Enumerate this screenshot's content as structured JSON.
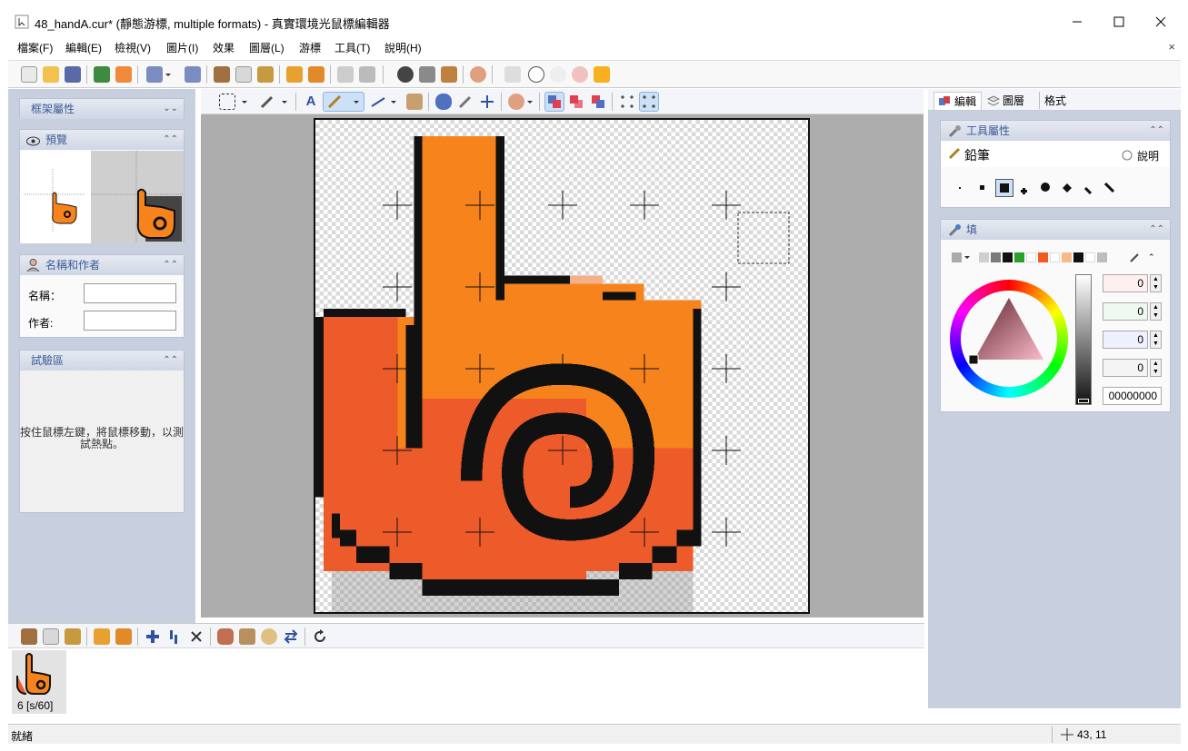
{
  "window": {
    "title": "48_handA.cur* (靜態游標, multiple formats) - 真實環境光鼠標編輯器",
    "close_doc": "×"
  },
  "menu": [
    "檔案(F)",
    "編輯(E)",
    "檢視(V)",
    "圖片(I)",
    "效果",
    "圖層(L)",
    "游標",
    "工具(T)",
    "說明(H)"
  ],
  "left_panel": {
    "frame_props": {
      "title": "框架屬性",
      "chev": "⌄⌄"
    },
    "preview": {
      "title": "預覽",
      "chev": "⌃⌃"
    },
    "name_author": {
      "title": "名稱和作者",
      "chev": "⌃⌃",
      "name_label": "名稱：",
      "name_value": "",
      "author_label": "作者:",
      "author_value": ""
    },
    "test_area": {
      "title": "試驗區",
      "chev": "⌃⌃",
      "hint": "按住鼠標左鍵，將鼠標移動，以測試熱點。"
    }
  },
  "right_panel": {
    "tabs": [
      "編輯",
      "圖層",
      "格式"
    ],
    "tool_props": {
      "title": "工具屬性",
      "tool_name": "鉛筆",
      "help": "說明"
    },
    "fill": {
      "title": "填",
      "values": [
        "0",
        "0",
        "0",
        "0"
      ],
      "hex": "00000000",
      "swatches": [
        "#cfcfcf",
        "#7a7a7a",
        "#111111",
        "#2ba12b",
        "#ffffff",
        "#f15a22",
        "#ffffff",
        "#f7b98a",
        "#111111",
        "#ffffff",
        "#bdbdbd"
      ]
    }
  },
  "frames": {
    "label": "6 [s/60]"
  },
  "statusbar": {
    "left": "就緒",
    "coords": "43, 11"
  },
  "colors": {
    "orange": "#f7831c",
    "orange_dark": "#ee5b2a",
    "outline": "#111111",
    "panel_bg": "#c8d0e0",
    "canvas_bg": "#adadad",
    "panel_title": "#3c5a99"
  }
}
